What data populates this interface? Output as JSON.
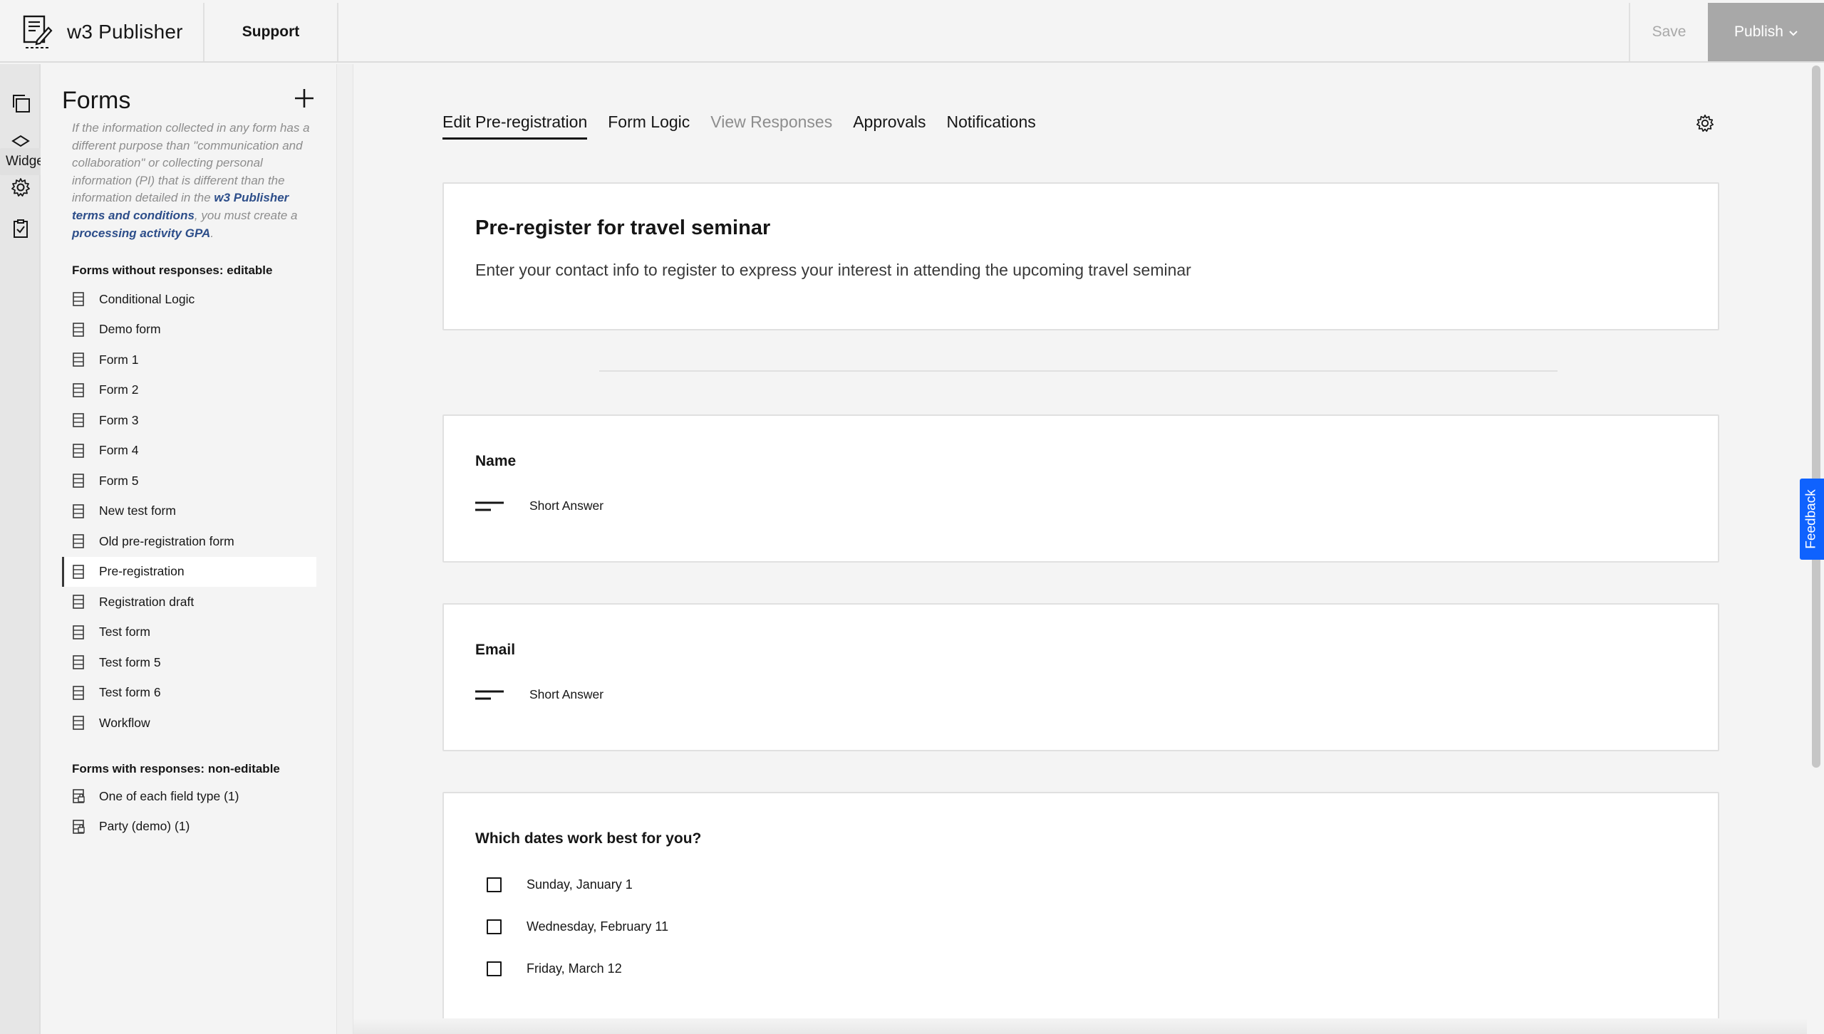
{
  "app": {
    "name": "w3 Publisher"
  },
  "header": {
    "support_label": "Support",
    "save_label": "Save",
    "publish_label": "Publish"
  },
  "rail": {
    "tooltip": "Widgets"
  },
  "panel": {
    "title": "Forms",
    "notice": {
      "text_before": "If the information collected in any form has a different purpose than \"communication and collaboration\" or collecting personal information (PI) that is different than the information detailed in the ",
      "link1": "w3 Publisher terms and conditions",
      "text_middle": ", you must create a ",
      "link2": "processing activity GPA",
      "text_after": "."
    },
    "editable_heading": "Forms without responses: editable",
    "editable_forms": [
      "Conditional Logic",
      "Demo form",
      "Form 1",
      "Form 2",
      "Form 3",
      "Form 4",
      "Form 5",
      "New test form",
      "Old pre-registration form",
      "Pre-registration",
      "Registration draft",
      "Test form",
      "Test form 5",
      "Test form 6",
      "Workflow"
    ],
    "noneditable_heading": "Forms with responses: non-editable",
    "noneditable_forms": [
      "One of each field type (1)",
      "Party (demo) (1)"
    ]
  },
  "tabs": [
    "Edit Pre-registration",
    "Form Logic",
    "View Responses",
    "Approvals",
    "Notifications"
  ],
  "form": {
    "title": "Pre-register for travel seminar",
    "description": "Enter your contact info to register to express your interest in attending the upcoming travel seminar",
    "questions": [
      {
        "label": "Name",
        "answer_type": "Short Answer"
      },
      {
        "label": "Email",
        "answer_type": "Short Answer"
      },
      {
        "label": "Which dates work best for you?",
        "options": [
          "Sunday, January 1",
          "Wednesday, February 11",
          "Friday, March 12"
        ]
      }
    ]
  },
  "feedback_label": "Feedback",
  "colors": {
    "accent": "#0f62fe",
    "publish_bg": "#a8a8a8"
  }
}
